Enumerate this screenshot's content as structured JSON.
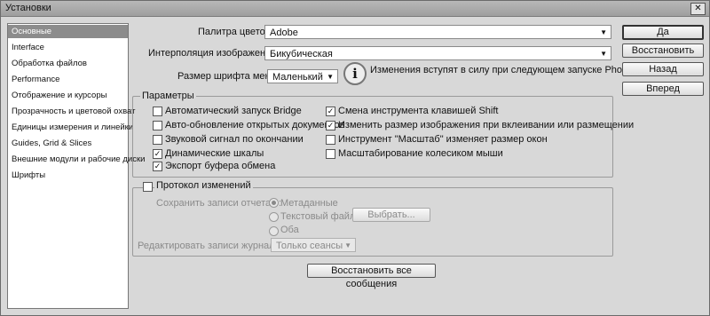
{
  "window": {
    "title": "Установки",
    "close_icon": "close-icon"
  },
  "sidebar": {
    "items": [
      {
        "label": "Основные",
        "selected": true
      },
      {
        "label": "Interface"
      },
      {
        "label": "Обработка файлов"
      },
      {
        "label": "Performance"
      },
      {
        "label": "Отображение и курсоры"
      },
      {
        "label": "Прозрачность и цветовой охват"
      },
      {
        "label": "Единицы измерения и линейки"
      },
      {
        "label": "Guides, Grid & Slices"
      },
      {
        "label": "Внешние модули и рабочие диски"
      },
      {
        "label": "Шрифты"
      }
    ]
  },
  "general": {
    "color_picker_label": "Палитра цветов:",
    "color_picker_value": "Adobe",
    "interpolation_label": "Интерполяция изображения:",
    "interpolation_value": "Бикубическая",
    "font_size_label": "Размер шрифта меню:",
    "font_size_value": "Маленький",
    "info_icon": "info-icon",
    "info_text": "Изменения вступят в силу при следующем запуске Photoshop."
  },
  "params": {
    "title": "Параметры",
    "left": [
      {
        "label": "Автоматический запуск Bridge",
        "checked": false
      },
      {
        "label": "Авто-обновление открытых документов",
        "checked": false
      },
      {
        "label": "Звуковой сигнал по окончании",
        "checked": false
      },
      {
        "label": "Динамические шкалы",
        "checked": true
      },
      {
        "label": "Экспорт буфера обмена",
        "checked": true
      }
    ],
    "right": [
      {
        "label": "Смена инструмента клавишей Shift",
        "checked": true
      },
      {
        "label": "Изменить размер изображения при вклеивании или размещении",
        "checked": true
      },
      {
        "label": "Инструмент \"Масштаб\" изменяет размер окон",
        "checked": false
      },
      {
        "label": "Масштабирование колесиком мыши",
        "checked": false
      }
    ]
  },
  "history": {
    "title": "Протокол изменений",
    "save_to_label": "Сохранить записи отчета в:",
    "opt_metadata": "Метаданные",
    "opt_textfile": "Текстовый файл",
    "opt_both": "Оба",
    "choose_label": "Выбрать...",
    "edit_log_label": "Редактировать записи журнала:",
    "edit_log_value": "Только сеансы"
  },
  "reset_messages_label": "Восстановить все сообщения",
  "buttons": {
    "ok": "Да",
    "reset": "Восстановить",
    "prev": "Назад",
    "next": "Вперед"
  }
}
